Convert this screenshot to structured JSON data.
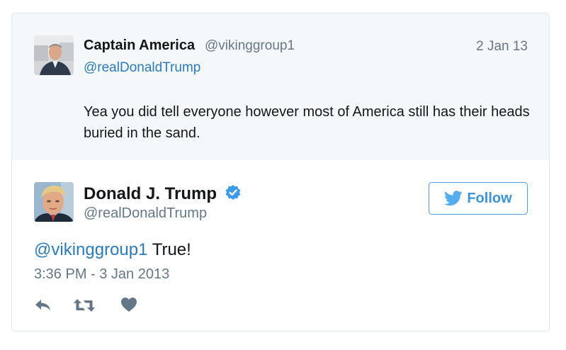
{
  "parent_tweet": {
    "author_name": "Captain America",
    "author_handle": "@vikinggroup1",
    "date": "2 Jan 13",
    "replying_to": "@realDonaldTrump",
    "text": "Yea you did tell everyone however most of America still has their heads buried in the sand."
  },
  "main_tweet": {
    "author_name": "Donald J. Trump",
    "author_handle": "@realDonaldTrump",
    "verified": true,
    "follow_label": "Follow",
    "mention": "@vikinggroup1",
    "text": " True!",
    "timestamp": "3:36 PM - 3 Jan 2013",
    "actions": [
      "reply-icon",
      "retweet-icon",
      "like-icon"
    ]
  },
  "colors": {
    "link": "#2b7bb9",
    "twitter_blue": "#3b94d9",
    "muted": "#657786",
    "parent_background": "#f5f8fa"
  }
}
